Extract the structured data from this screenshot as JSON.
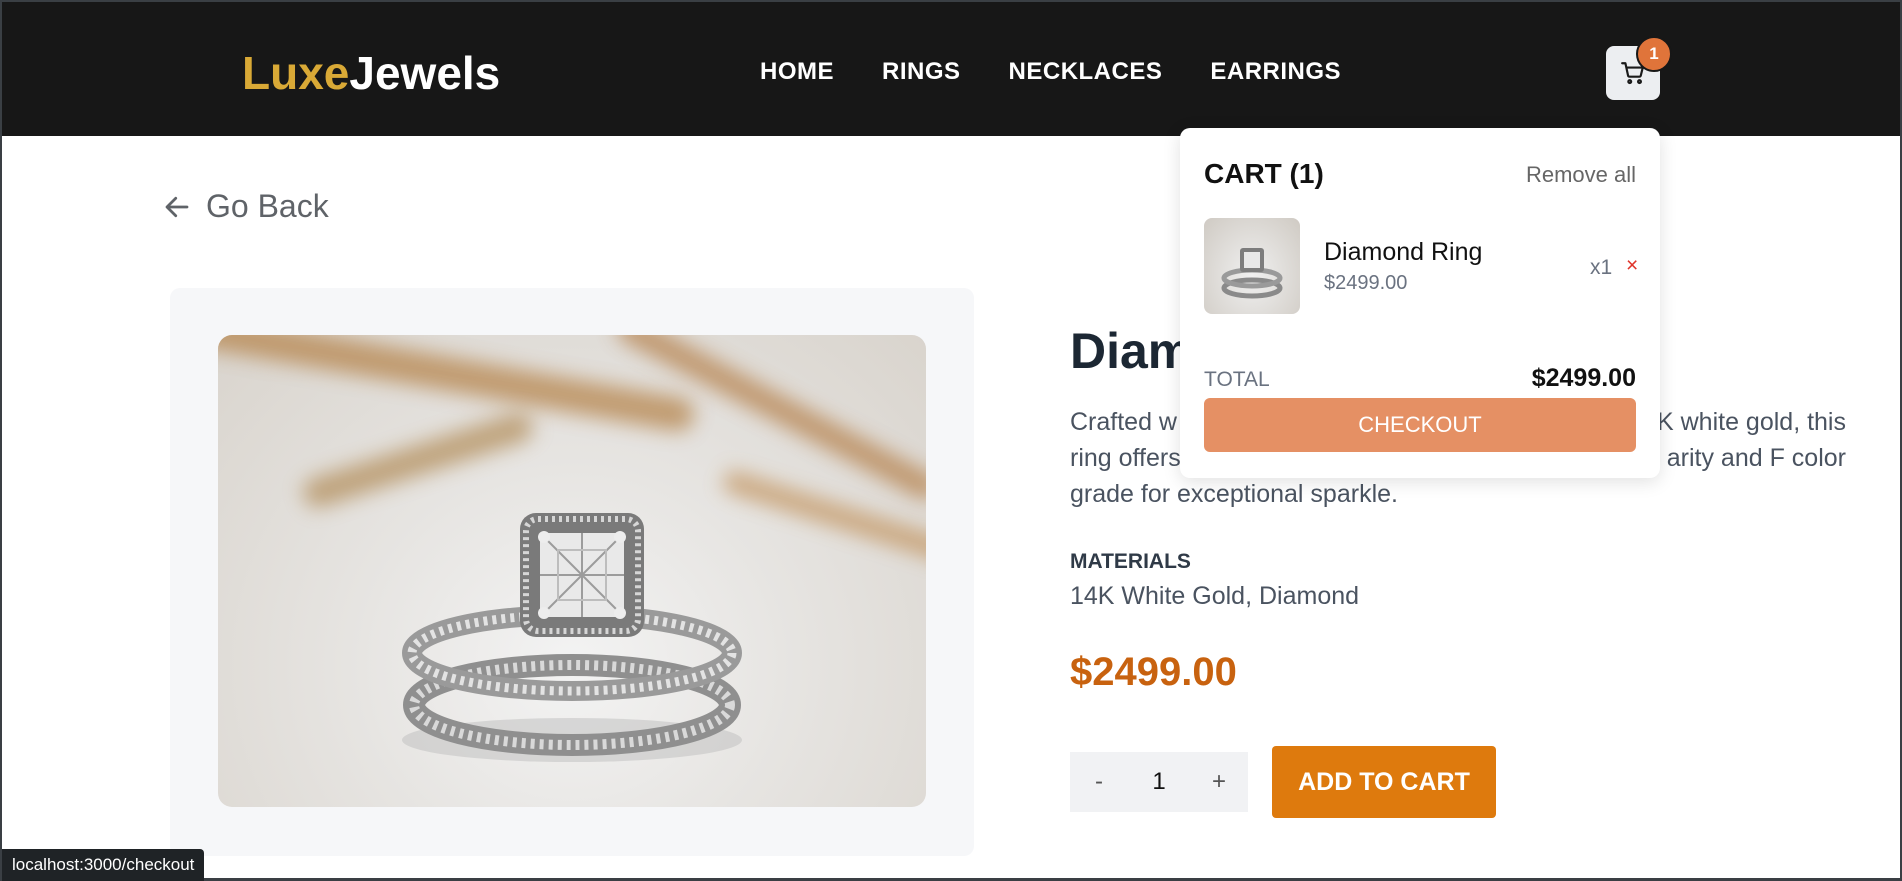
{
  "header": {
    "logo_part1": "Luxe",
    "logo_part2": "Jewels",
    "nav": [
      "HOME",
      "RINGS",
      "NECKLACES",
      "EARRINGS"
    ],
    "cart_count": "1",
    "cart_icon": "shopping-cart-icon"
  },
  "go_back": {
    "label": "Go Back",
    "icon": "arrow-left-icon"
  },
  "product": {
    "title": "Diamond Ring",
    "title_visible": "Diam",
    "description_line1_left": "Crafted w",
    "description_line1_right": "K white gold, this",
    "description_line2_left": "ring offers",
    "description_line2_right": "arity and F color",
    "description_line3": "grade for exceptional sparkle.",
    "materials_label": "MATERIALS",
    "materials_value": "14K White Gold, Diamond",
    "price": "$2499.00",
    "quantity": "1",
    "qty_minus": "-",
    "qty_plus": "+",
    "add_to_cart": "ADD TO CART"
  },
  "cart": {
    "title": "CART (1)",
    "remove_all": "Remove all",
    "items": [
      {
        "name": "Diamond Ring",
        "price": "$2499.00",
        "qty": "x1",
        "remove": "×"
      }
    ],
    "total_label": "TOTAL",
    "total_value": "$2499.00",
    "checkout": "CHECKOUT"
  },
  "status_bar": {
    "url": "localhost:3000/checkout"
  },
  "colors": {
    "header_bg": "#171717",
    "logo_gold": "#D9A936",
    "accent_orange": "#DE7A0D",
    "price_color": "#C8620F",
    "checkout_bg": "#E59064",
    "badge_bg": "#E0743A"
  }
}
